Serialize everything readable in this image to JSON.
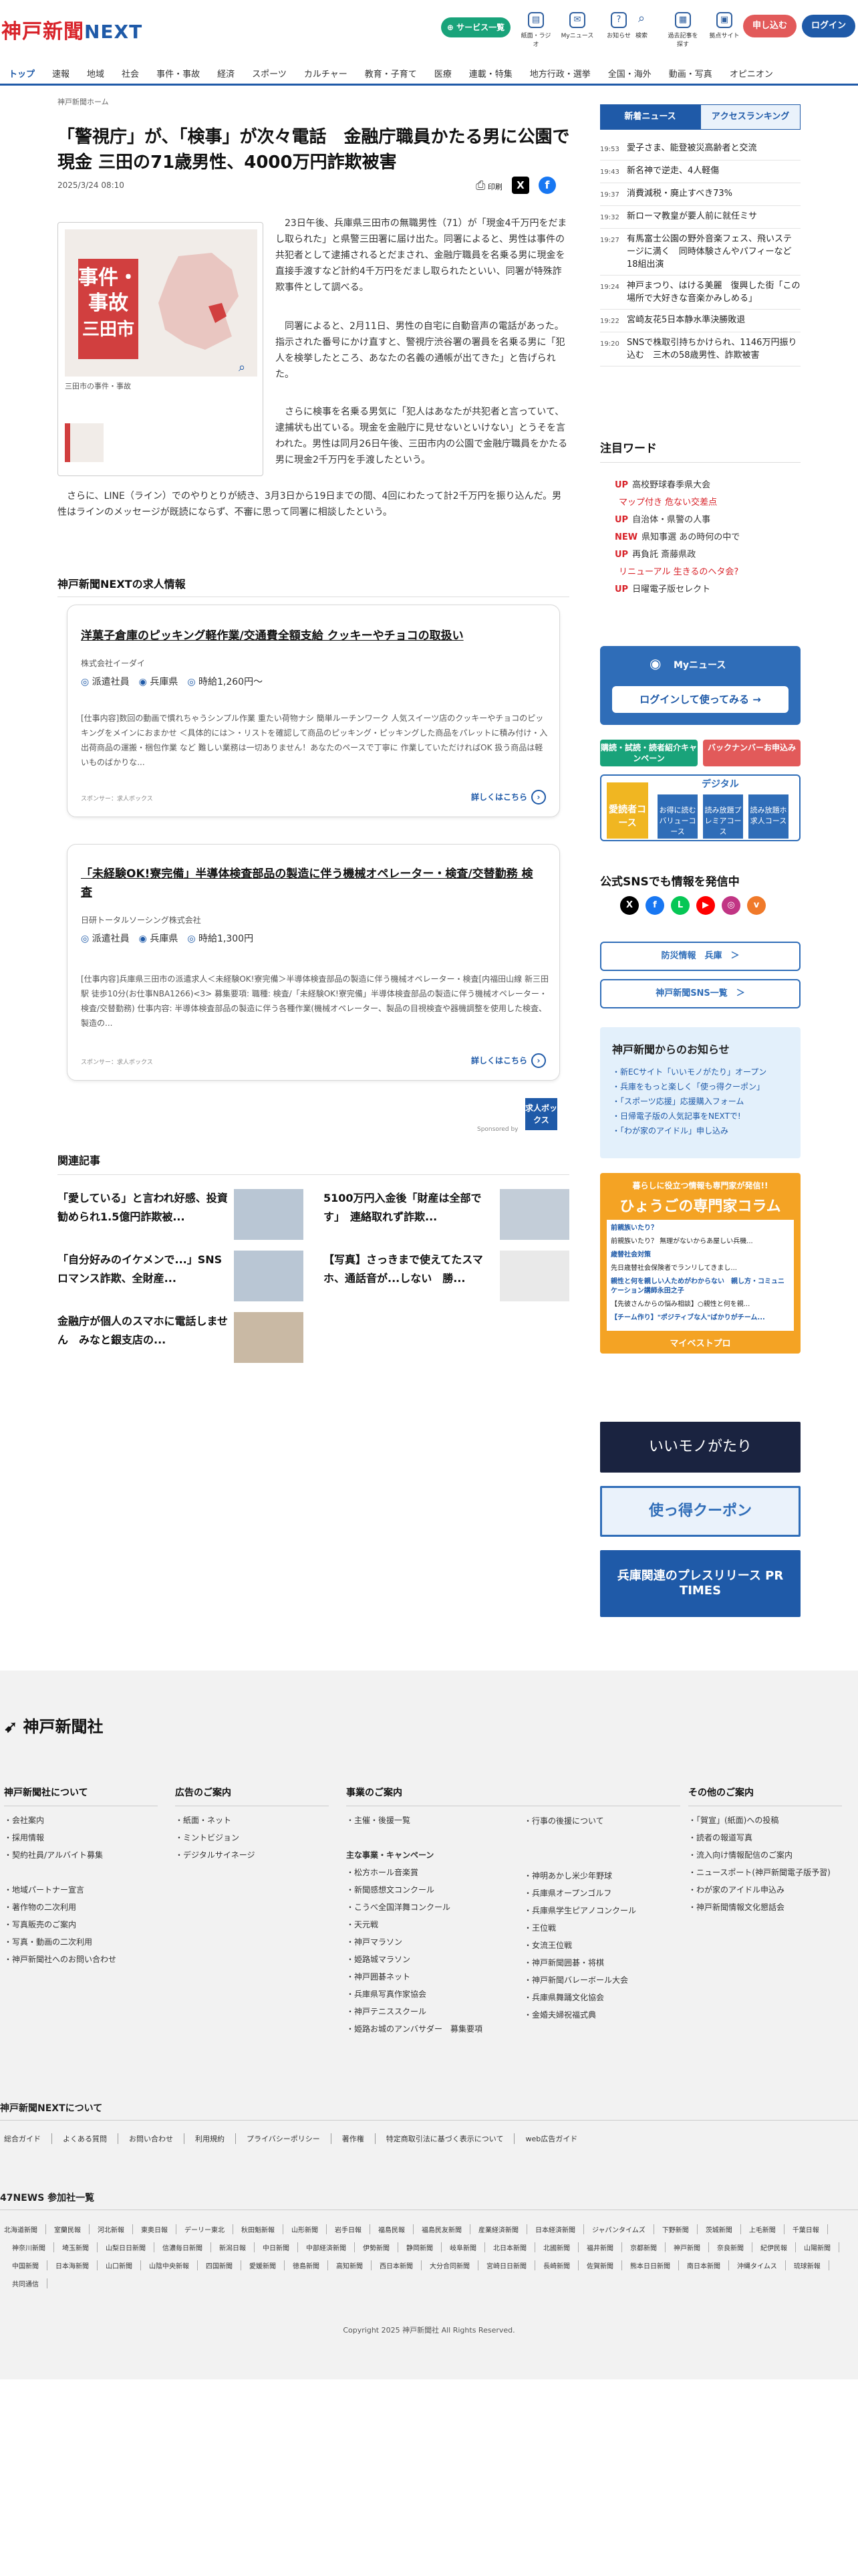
{
  "header": {
    "logo_main": "神戸新聞",
    "logo_next": "NEXT",
    "service_label": "サービス一覧",
    "icons": [
      {
        "icon": "paper-icon",
        "label": "紙面・ラジオ"
      },
      {
        "icon": "mynews-icon",
        "label": "Myニュース"
      },
      {
        "icon": "help-icon",
        "label": "お知らせ"
      },
      {
        "icon": "search-icon",
        "label": "検索"
      },
      {
        "icon": "past-icon",
        "label": "過去記事を探す"
      },
      {
        "icon": "mail-icon",
        "label": "拠点サイト"
      }
    ],
    "apply_label": "申し込む",
    "login_label": "ログイン"
  },
  "nav": [
    "トップ",
    "速報",
    "地域",
    "社会",
    "事件・事故",
    "経済",
    "スポーツ",
    "カルチャー",
    "教育・子育て",
    "医療",
    "連載・特集",
    "地方行政・選挙",
    "全国・海外",
    "動画・写真",
    "オピニオン"
  ],
  "article": {
    "breadcrumb": "神戸新聞ホーム",
    "title": "「警視庁」が、「検事」が次々電話　金融庁職員かたる男に公園で現金 三田の71歳男性、4000万円詐欺被害",
    "date": "2025/3/24 08:10",
    "print_label": "印刷",
    "figure_tag_1": "事件・",
    "figure_tag_2": "事故",
    "figure_tag_3": "三田市",
    "figure_caption": "三田市の事件・事故",
    "p1": "　23日午後、兵庫県三田市の無職男性（71）が「現金4千万円をだまし取られた」と県警三田署に届け出た。同署によると、男性は事件の共犯者として逮捕されるとだまされ、金融庁職員を名乗る男に現金を直接手渡すなど計約4千万円をだまし取られたといい、同署が特殊詐欺事件として調べる。",
    "p2": "　同署によると、2月11日、男性の自宅に自動音声の電話があった。指示された番号にかけ直すと、警視庁渋谷署の署員を名乗る男に「犯人を検挙したところ、あなたの名義の通帳が出てきた」と告げられた。",
    "p3": "　さらに検事を名乗る男気に「犯人はあなたが共犯者と言っていて、逮捕状も出ている。現金を金融庁に見せないといけない」とうそを言われた。男性は同月26日午後、三田市内の公園で金融庁職員をかたる男に現金2千万円を手渡したという。",
    "p4": "　さらに、LINE（ライン）でのやりとりが続き、3月3日から19日までの間、4回にわたって計2千万円を振り込んだ。男性はラインのメッセージが既読にならず、不審に思って同署に相談したという。"
  },
  "jobs": {
    "heading": "神戸新聞NEXTの求人情報",
    "items": [
      {
        "title": "洋菓子倉庫のピッキング軽作業/交通費全額支給 クッキーやチョコの取扱い",
        "company": "株式会社イーダイ",
        "type": "派遣社員",
        "place": "兵庫県",
        "wage": "時給1,260円〜",
        "desc": "[仕事内容]数回の動画で慣れちゃうシンプル作業 重たい荷物ナシ 簡単ルーチンワーク 人気スイーツ店のクッキーやチョコのピッキングをメインにおまかせ ＜具体的には＞・リストを確認して商品のピッキング・ピッキングした商品をパレットに積み付け・入出荷商品の運搬・梱包作業 など 難しい業務は一切ありません！あなたのペースで丁寧に 作業していただければOK 扱う商品は軽いものばかりな...",
        "sponsor": "スポンサー：求人ボックス",
        "more": "詳しくはこちら"
      },
      {
        "title": "「未経験OK!寮完備」半導体検査部品の製造に伴う機械オペレーター・検査/交替勤務 検査",
        "company": "日研トータルソーシング株式会社",
        "type": "派遣社員",
        "place": "兵庫県",
        "wage": "時給1,300円",
        "desc": "[仕事内容]兵庫県三田市の派遣求人＜未経験OK!寮完備＞半導体検査部品の製造に伴う機械オペレーター・検査[内福田山線 新三田駅 徒歩10分(お仕事NBA1266)<3> 募集要項: 職種: 検査/「未経験OK!寮完備」半導体検査部品の製造に伴う機械オペレーター・検査/交替勤務) 仕事内容: 半導体検査部品の製造に伴う各種作業(機械オペレーター、製品の目視検査や器機調整を使用した検査、製造の...",
        "sponsor": "スポンサー：求人ボックス",
        "more": "詳しくはこちら"
      }
    ],
    "badge": "求人ボックス",
    "sponsored": "Sponsored by"
  },
  "related": {
    "heading": "関連記事",
    "items": [
      "「愛している」と言われ好感、投資勧められ1.5億円詐欺被...",
      "5100万円入金後「財産は全部です」　連絡取れず詐欺...",
      "「自分好みのイケメンで...」SNSロマンス詐欺、全財産...",
      "【写真】さっきまで使えてたスマホ、通話音が...しない　勝...",
      "金融庁が個人のスマホに電話しません　みなと銀支店の..."
    ]
  },
  "sidebar": {
    "tab_new": "新着ニュース",
    "tab_access": "アクセスランキング",
    "news": [
      {
        "time": "19:53",
        "text": "愛子さま、能登被災高齢者と交流"
      },
      {
        "time": "19:43",
        "text": "新名神で逆走、4人軽傷"
      },
      {
        "time": "19:37",
        "text": "消費減税・廃止すべき73%"
      },
      {
        "time": "19:32",
        "text": "新ローマ教皇が要人前に就任ミサ"
      },
      {
        "time": "19:27",
        "text": "有馬富士公園の野外音楽フェス、飛いステージに満く　同時体験さんやパフィーなど18組出演"
      },
      {
        "time": "19:24",
        "text": "神戸まつり、はける美麗　復興した街「この場所で大好きな音楽かみしめる」"
      },
      {
        "time": "19:22",
        "text": "宮崎友花5日本静水準決勝敗退"
      },
      {
        "time": "19:20",
        "text": "SNSで株取引持ちかけられ、1146万円振り込む　三木の58歳男性、詐欺被害"
      }
    ],
    "keyword_heading": "注目ワード",
    "keywords": [
      {
        "tag": "UP",
        "text": "高校野球春季県大会"
      },
      {
        "tag": "",
        "text": "マップ付き 危ない交差点"
      },
      {
        "tag": "UP",
        "text": "自治体・県警の人事"
      },
      {
        "tag": "NEW",
        "text": "県知事選 あの時何の中で"
      },
      {
        "tag": "UP",
        "text": "再負託 斎藤県政"
      },
      {
        "tag": "",
        "text": "リニューアル 生きるのヘタ会?"
      },
      {
        "tag": "UP",
        "text": "日曜電子版セレクト"
      }
    ],
    "mynews_title": "Myニュース",
    "mynews_login": "ログインして使ってみる",
    "promo_1": "購読・試読・読者紹介キャンペーン",
    "promo_2": "バックナンバーお申込み",
    "digital_label": "デジタル",
    "digital_plans": [
      "愛読者コース",
      "お得に読むバリューコース",
      "読み放題プレミアコース",
      "読み放題ホ求人コース"
    ],
    "sns_heading": "公式SNSでも情報を発信中",
    "sns_icons": [
      "X",
      "f",
      "L",
      "▶",
      "◎",
      "v"
    ],
    "bousai_btn": "防災情報　兵庫　＞",
    "snslist_btn": "神戸新聞SNS一覧　＞",
    "notice_title": "神戸新聞からのお知らせ",
    "notices": [
      "・新ECサイト「いいモノがたり」オープン",
      "・兵庫をもっと楽しく「使っ得クーポン」",
      "・「スポーツ応援」応援購入フォーム",
      "・日帰電子版の人気記事をNEXTで!",
      "・「わが家のアイドル」申し込み"
    ],
    "column_sub": "暮らしに役立つ情報も専門家が発信!!",
    "column_title": "ひょうごの専門家コラム",
    "column_items": [
      {
        "h": "前親族いたり？",
        "t": "前親族いたり？ 無理がないからあ屋しい兵機..."
      },
      {
        "h": "歳替社会対策",
        "t": "先日歳替社会保険者でランリしてきまし..."
      },
      {
        "h": "親性と何を親しい人ためがわからない　親し方・コミュニケーション講師永田之子",
        "t": "【先彼さんからの悩み相談】○親性と何を親..."
      },
      {
        "h": "【チーム作り】\"ポジティブな人\"ばかりがチーム...",
        "t": ""
      }
    ],
    "column_foot": "マイベストプロ",
    "banner_1": "いいモノがたり",
    "banner_2": "使っ得クーポン",
    "banner_3": "兵庫関連のプレスリリース PR TIMES"
  },
  "footer": {
    "logo": "神戸新聞社",
    "col1_h": "神戸新聞社について",
    "col1": [
      "・会社案内",
      "・採用情報",
      "・契約社員/アルバイト募集",
      "",
      "・地域パートナー宣言",
      "・著作物の二次利用",
      "・写真販売のご案内",
      "・写真・動画の二次利用",
      "・神戸新聞社へのお問い合わせ"
    ],
    "col2_h": "広告のご案内",
    "col2": [
      "・紙面・ネット",
      "・ミントビジョン",
      "・デジタルサイネージ"
    ],
    "col3_h": "事業のご案内",
    "col3a": [
      "・主催・後援一覧"
    ],
    "col3b": [
      "・行事の後援について"
    ],
    "col3_sub": "主な事業・キャンペーン",
    "col3c": [
      "・松方ホール音楽賞",
      "・新聞感想文コンクール",
      "・こうべ全国洋舞コンクール",
      "・天元戦",
      "・神戸マラソン",
      "・姫路城マラソン",
      "・神戸囲碁ネット",
      "・兵庫県写真作家協会",
      "・神戸テニススクール",
      "・姫路お城のアンバサダー　募集要項"
    ],
    "col3d": [
      "・神明あかし米少年野球",
      "・兵庫県オープンゴルフ",
      "・兵庫県学生ピアノコンクール",
      "・王位戦",
      "・女流王位戦",
      "・神戸新聞囲碁・将棋",
      "・神戸新聞バレーボール大会",
      "・兵庫県舞踊文化協会",
      "・金婚夫婦祝福式典"
    ],
    "col4_h": "その他のご案内",
    "col4": [
      "・「賀宣」(紙面)への投稿",
      "・読者の報道写真",
      "・流入向け情報配信のご案内",
      "・ニュースポート(神戸新聞電子版予習)",
      "・わが家のアイドル申込み",
      "・神戸新聞情報文化懇話会"
    ],
    "next_h": "神戸新聞NEXTについて",
    "next_links": [
      "総合ガイド",
      "よくある質問",
      "お問い合わせ",
      "利用規約",
      "プライバシーポリシー",
      "著作権",
      "特定商取引法に基づく表示について",
      "web広告ガイド"
    ],
    "p47_h": "47NEWS 参加社一覧",
    "p47": [
      "北海道新聞",
      "室蘭民報",
      "河北新報",
      "東奥日報",
      "デーリー東北",
      "秋田魁新報",
      "山形新聞",
      "岩手日報",
      "福島民報",
      "福島民友新聞",
      "産業経済新聞",
      "日本経済新聞",
      "ジャパンタイムズ",
      "下野新聞",
      "茨城新聞",
      "上毛新聞",
      "千葉日報",
      "神奈川新聞",
      "埼玉新聞",
      "山梨日日新聞",
      "信濃毎日新聞",
      "新潟日報",
      "中日新聞",
      "中部経済新聞",
      "伊勢新聞",
      "静岡新聞",
      "岐阜新聞",
      "北日本新聞",
      "北國新聞",
      "福井新聞",
      "京都新聞",
      "神戸新聞",
      "奈良新聞",
      "紀伊民報",
      "山陽新聞",
      "中国新聞",
      "日本海新聞",
      "山口新聞",
      "山陰中央新報",
      "四国新聞",
      "愛媛新聞",
      "徳島新聞",
      "高知新聞",
      "西日本新聞",
      "大分合同新聞",
      "宮崎日日新聞",
      "長崎新聞",
      "佐賀新聞",
      "熊本日日新聞",
      "南日本新聞",
      "沖縄タイムス",
      "琉球新報",
      "共同通信"
    ],
    "copyright": "Copyright 2025 神戸新聞社 All Rights Reserved."
  }
}
